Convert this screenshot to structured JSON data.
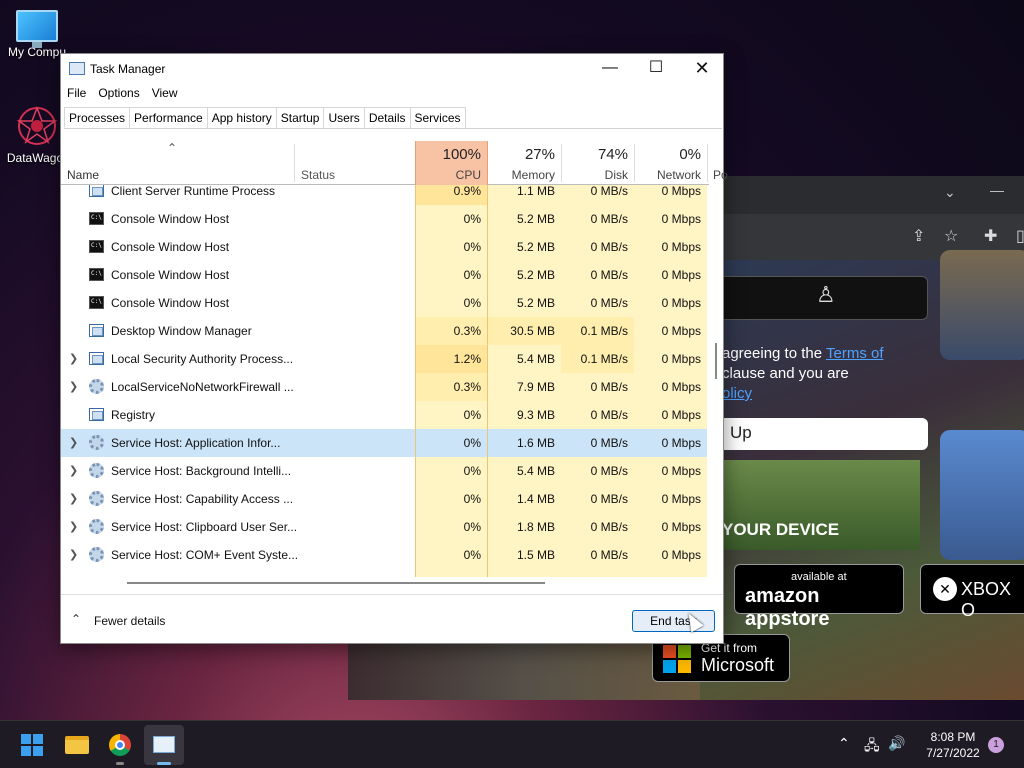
{
  "desktop": {
    "icons": [
      {
        "label": "My Compu"
      },
      {
        "label": "DataWagor"
      }
    ]
  },
  "browser": {
    "terms_line1": "agreeing to the ",
    "terms_link1": "Terms of",
    "terms_line2": "clause and you are",
    "terms_link2": "olicy",
    "signup_label": "Up",
    "device_heading": "YOUR DEVICE",
    "amazon_small": "available at",
    "amazon_big": "amazon appstore",
    "xbox_label": "XBOX O",
    "ms_small": "Get it from",
    "ms_big": "Microsoft"
  },
  "window": {
    "title": "Task Manager",
    "menu": [
      "File",
      "Options",
      "View"
    ],
    "tabs": [
      "Processes",
      "Performance",
      "App history",
      "Startup",
      "Users",
      "Details",
      "Services"
    ]
  },
  "table": {
    "headers": {
      "name": "Name",
      "status": "Status",
      "cpu_pct": "100%",
      "cpu": "CPU",
      "mem_pct": "27%",
      "mem": "Memory",
      "disk_pct": "74%",
      "disk": "Disk",
      "net_pct": "0%",
      "net": "Network",
      "power_partial": "Po"
    },
    "rows": [
      {
        "name": "Client Server Runtime Process",
        "cpu": "0.9%",
        "mem": "1.1 MB",
        "disk": "0 MB/s",
        "net": "0 Mbps"
      },
      {
        "name": "Console Window Host",
        "cpu": "0%",
        "mem": "5.2 MB",
        "disk": "0 MB/s",
        "net": "0 Mbps"
      },
      {
        "name": "Console Window Host",
        "cpu": "0%",
        "mem": "5.2 MB",
        "disk": "0 MB/s",
        "net": "0 Mbps"
      },
      {
        "name": "Console Window Host",
        "cpu": "0%",
        "mem": "5.2 MB",
        "disk": "0 MB/s",
        "net": "0 Mbps"
      },
      {
        "name": "Console Window Host",
        "cpu": "0%",
        "mem": "5.2 MB",
        "disk": "0 MB/s",
        "net": "0 Mbps"
      },
      {
        "name": "Desktop Window Manager",
        "cpu": "0.3%",
        "mem": "30.5 MB",
        "disk": "0.1 MB/s",
        "net": "0 Mbps"
      },
      {
        "name": "Local Security Authority Process...",
        "cpu": "1.2%",
        "mem": "5.4 MB",
        "disk": "0.1 MB/s",
        "net": "0 Mbps"
      },
      {
        "name": "LocalServiceNoNetworkFirewall ...",
        "cpu": "0.3%",
        "mem": "7.9 MB",
        "disk": "0 MB/s",
        "net": "0 Mbps"
      },
      {
        "name": "Registry",
        "cpu": "0%",
        "mem": "9.3 MB",
        "disk": "0 MB/s",
        "net": "0 Mbps"
      },
      {
        "name": "Service Host: Application Infor...",
        "cpu": "0%",
        "mem": "1.6 MB",
        "disk": "0 MB/s",
        "net": "0 Mbps"
      },
      {
        "name": "Service Host: Background Intelli...",
        "cpu": "0%",
        "mem": "5.4 MB",
        "disk": "0 MB/s",
        "net": "0 Mbps"
      },
      {
        "name": "Service Host: Capability Access ...",
        "cpu": "0%",
        "mem": "1.4 MB",
        "disk": "0 MB/s",
        "net": "0 Mbps"
      },
      {
        "name": "Service Host: Clipboard User Ser...",
        "cpu": "0%",
        "mem": "1.8 MB",
        "disk": "0 MB/s",
        "net": "0 Mbps"
      },
      {
        "name": "Service Host: COM+ Event Syste...",
        "cpu": "0%",
        "mem": "1.5 MB",
        "disk": "0 MB/s",
        "net": "0 Mbps"
      }
    ]
  },
  "footer": {
    "fewer_details": "Fewer details",
    "end_task": "End task"
  },
  "taskbar": {
    "time": "8:08 PM",
    "date": "7/27/2022",
    "notification_count": "1"
  }
}
